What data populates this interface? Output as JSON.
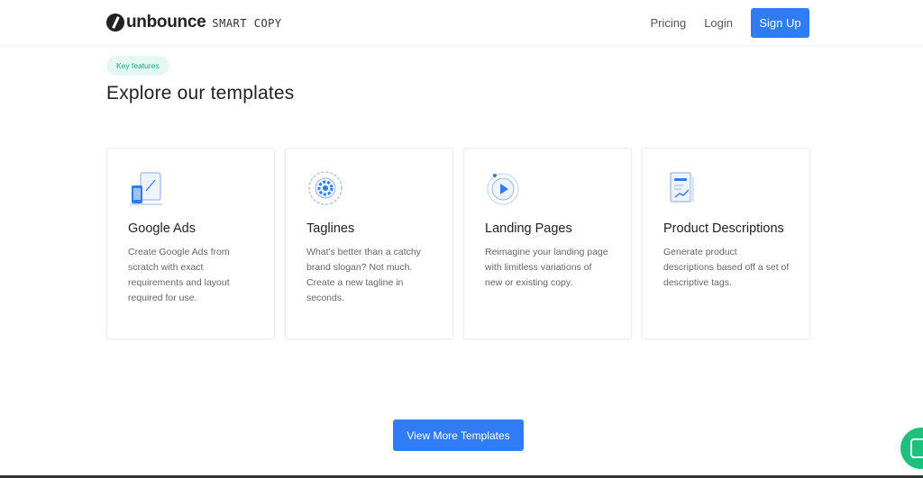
{
  "header": {
    "logo_text": "unbounce",
    "logo_sub": "SMART COPY",
    "nav": {
      "pricing": "Pricing",
      "login": "Login",
      "signup": "Sign Up"
    }
  },
  "section": {
    "pill": "Key features",
    "title": "Explore our templates",
    "cards": [
      {
        "title": "Google Ads",
        "desc": "Create Google Ads from scratch with exact requirements and layout required for use.",
        "icon": "devices-icon"
      },
      {
        "title": "Taglines",
        "desc": "What's better than a catchy brand slogan? Not much. Create a new tagline in seconds.",
        "icon": "gear-icon"
      },
      {
        "title": "Landing Pages",
        "desc": "Reimagine your landing page with limitless variations of new or existing copy.",
        "icon": "play-icon"
      },
      {
        "title": "Product Descriptions",
        "desc": "Generate product descriptions based off a set of descriptive tags.",
        "icon": "document-chart-icon"
      }
    ],
    "more_button": "View More Templates"
  },
  "colors": {
    "accent": "#2f7cf6",
    "pill_bg": "#e6f8f3",
    "pill_text": "#1aa57a",
    "chat": "#1fbf7d"
  }
}
